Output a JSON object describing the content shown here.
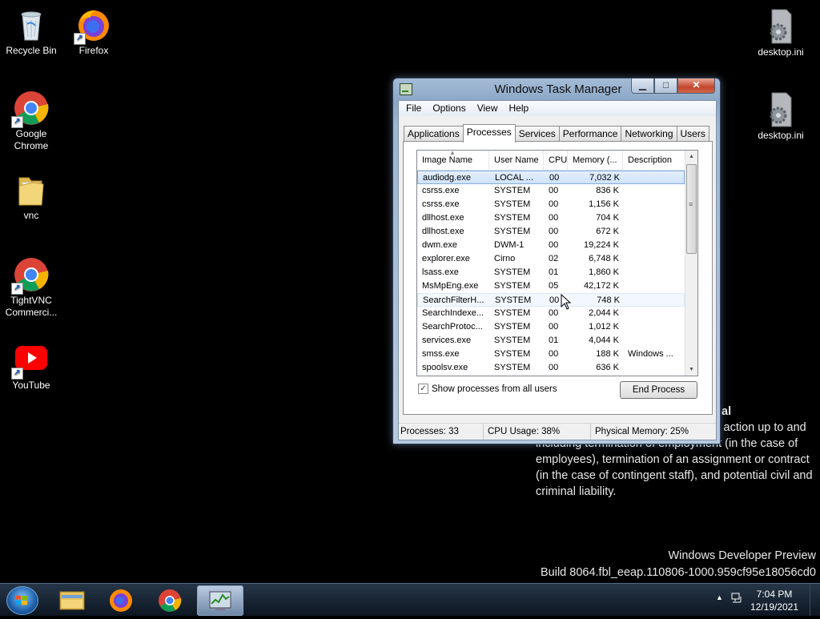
{
  "desktop": {
    "icons": [
      {
        "label": "Recycle Bin",
        "icon": "recycle-bin-icon"
      },
      {
        "label": "Firefox",
        "icon": "firefox-icon"
      },
      {
        "label": "Google Chrome",
        "icon": "chrome-icon"
      },
      {
        "label": "vnc",
        "icon": "folder-icon"
      },
      {
        "label": "TightVNC Commerci...",
        "icon": "chrome-icon"
      },
      {
        "label": "YouTube",
        "icon": "youtube-icon"
      },
      {
        "label": "desktop.ini",
        "icon": "settings-file-icon"
      },
      {
        "label": "desktop.ini",
        "icon": "settings-file-icon"
      }
    ],
    "background_title": "ial",
    "background_text": "ny manner may result in disciplinary action up to and including termination of employment (in the case of employees), termination of an assignment or contract (in the case of contingent staff), and potential civil and criminal liability.",
    "watermark_line1": "Windows Developer Preview",
    "watermark_line2": "Build 8064.fbl_eeap.110806-1000.959cf95e18056cd0"
  },
  "window": {
    "title": "Windows Task Manager",
    "minimize": "▁",
    "maximize": "□",
    "close": "✕",
    "menu": [
      "File",
      "Options",
      "View",
      "Help"
    ],
    "tabs": [
      "Applications",
      "Processes",
      "Services",
      "Performance",
      "Networking",
      "Users"
    ],
    "active_tab": "Processes",
    "columns": [
      "Image Name",
      "User Name",
      "CPU",
      "Memory (...",
      "Description"
    ],
    "processes": [
      {
        "name": "audiodg.exe",
        "user": "LOCAL ...",
        "cpu": "00",
        "mem": "7,032 K",
        "desc": ""
      },
      {
        "name": "csrss.exe",
        "user": "SYSTEM",
        "cpu": "00",
        "mem": "836 K",
        "desc": ""
      },
      {
        "name": "csrss.exe",
        "user": "SYSTEM",
        "cpu": "00",
        "mem": "1,156 K",
        "desc": ""
      },
      {
        "name": "dllhost.exe",
        "user": "SYSTEM",
        "cpu": "00",
        "mem": "704 K",
        "desc": ""
      },
      {
        "name": "dllhost.exe",
        "user": "SYSTEM",
        "cpu": "00",
        "mem": "672 K",
        "desc": ""
      },
      {
        "name": "dwm.exe",
        "user": "DWM-1",
        "cpu": "00",
        "mem": "19,224 K",
        "desc": ""
      },
      {
        "name": "explorer.exe",
        "user": "Cirno",
        "cpu": "02",
        "mem": "6,748 K",
        "desc": ""
      },
      {
        "name": "lsass.exe",
        "user": "SYSTEM",
        "cpu": "01",
        "mem": "1,860 K",
        "desc": ""
      },
      {
        "name": "MsMpEng.exe",
        "user": "SYSTEM",
        "cpu": "05",
        "mem": "42,172 K",
        "desc": ""
      },
      {
        "name": "SearchFilterH...",
        "user": "SYSTEM",
        "cpu": "00",
        "mem": "748 K",
        "desc": ""
      },
      {
        "name": "SearchIndexe...",
        "user": "SYSTEM",
        "cpu": "00",
        "mem": "2,044 K",
        "desc": ""
      },
      {
        "name": "SearchProtoc...",
        "user": "SYSTEM",
        "cpu": "00",
        "mem": "1,012 K",
        "desc": ""
      },
      {
        "name": "services.exe",
        "user": "SYSTEM",
        "cpu": "01",
        "mem": "4,044 K",
        "desc": ""
      },
      {
        "name": "smss.exe",
        "user": "SYSTEM",
        "cpu": "00",
        "mem": "188 K",
        "desc": "Windows ..."
      },
      {
        "name": "spoolsv.exe",
        "user": "SYSTEM",
        "cpu": "00",
        "mem": "636 K",
        "desc": ""
      }
    ],
    "selected_row": 0,
    "hover_row": 9,
    "show_all_label": "Show processes from all users",
    "show_all_checked": true,
    "end_process_label": "End Process",
    "status": {
      "processes": "Processes: 33",
      "cpu": "CPU Usage: 38%",
      "memory": "Physical Memory: 25%"
    }
  },
  "taskbar": {
    "items": [
      "start-button",
      "explorer-icon",
      "firefox-icon",
      "chrome-icon",
      "task-manager-icon"
    ],
    "active_item": "task-manager-icon",
    "time": "7:04 PM",
    "date": "12/19/2021"
  }
}
